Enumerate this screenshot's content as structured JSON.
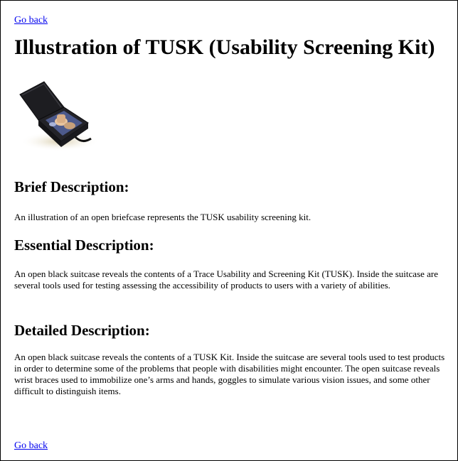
{
  "nav": {
    "top_back": "Go back",
    "bottom_back": "Go back"
  },
  "page": {
    "title": "Illustration of TUSK (Usability Screening Kit)"
  },
  "sections": {
    "brief": {
      "heading": "Brief Description:",
      "text": "An illustration of an open briefcase represents the TUSK usability screening kit."
    },
    "essential": {
      "heading": "Essential Description:",
      "text": "An open black suitcase reveals the contents of a Trace Usability and Screening Kit (TUSK). Inside the suitcase are several tools used for testing assessing the accessibility of products to users with a variety of abilities."
    },
    "detailed": {
      "heading": "Detailed Description:",
      "text": "An open black suitcase reveals the contents of a TUSK Kit. Inside the suitcase are several tools used to test products in order to determine some of the problems that people with disabilities might encounter. The open suitcase reveals wrist braces used to immobilize one’s arms and hands, goggles to simulate various vision issues, and some other difficult to distinguish items."
    }
  },
  "colors": {
    "link": "#0000ee",
    "suitcase": "#1f1f23",
    "background": "#ffffff"
  }
}
